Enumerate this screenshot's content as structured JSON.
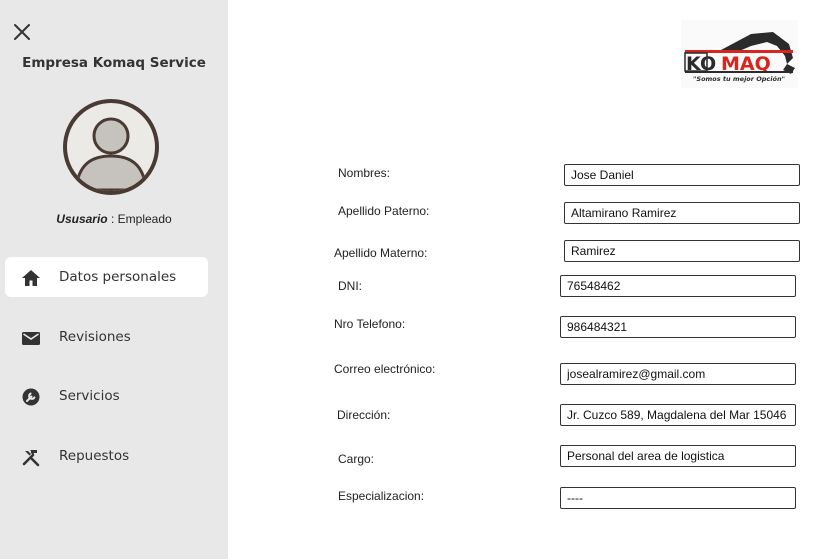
{
  "sidebar": {
    "company_name": "Empresa Komaq Service",
    "user_key": "Ususario",
    "user_separator": " : ",
    "user_role": "Empleado",
    "items": [
      {
        "label": "Datos personales",
        "icon": "home-icon",
        "active": true
      },
      {
        "label": "Revisiones",
        "icon": "mail-icon",
        "active": false
      },
      {
        "label": "Servicios",
        "icon": "wrench-icon",
        "active": false
      },
      {
        "label": "Repuestos",
        "icon": "tools-icon",
        "active": false
      }
    ]
  },
  "logo": {
    "brand_text": "KOMAQ",
    "tagline": "\"Somos tu mejor Opción\""
  },
  "form": {
    "fields": [
      {
        "label": "Nombres:",
        "value": "Jose Daniel"
      },
      {
        "label": "Apellido Paterno:",
        "value": "Altamirano Ramirez"
      },
      {
        "label": "Apellido Materno:",
        "value": "Ramirez"
      },
      {
        "label": "DNI:",
        "value": "76548462"
      },
      {
        "label": "Nro Telefono:",
        "value": "986484321"
      },
      {
        "label": "Correo electrónico:",
        "value": "josealramirez@gmail.com"
      },
      {
        "label": "Dirección:",
        "value": "Jr. Cuzco 589, Magdalena del Mar 15046"
      },
      {
        "label": "Cargo:",
        "value": "Personal del area de logistica"
      },
      {
        "label": "Especializacion:",
        "value": "----"
      }
    ]
  },
  "colors": {
    "sidebar_bg": "#e8e8e8",
    "active_item_bg": "#ffffff",
    "logo_red": "#d7261e",
    "logo_dark": "#2b2b2b"
  }
}
